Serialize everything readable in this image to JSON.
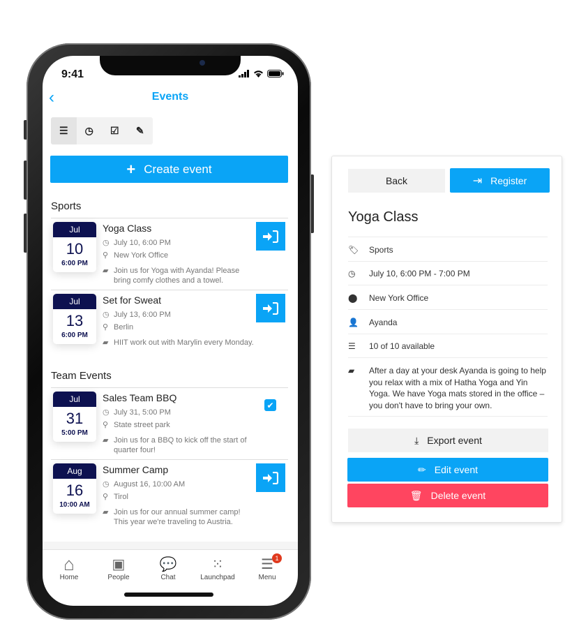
{
  "status": {
    "time": "9:41"
  },
  "nav": {
    "title": "Events"
  },
  "create_label": "Create event",
  "sections": [
    {
      "title": "Sports",
      "events": [
        {
          "month": "Jul",
          "day": "10",
          "time": "6:00 PM",
          "title": "Yoga Class",
          "when": "July 10, 6:00 PM",
          "where": "New York Office",
          "desc": "Join us for Yoga with Ayanda! Please bring comfy clothes and a towel.",
          "registered": false
        },
        {
          "month": "Jul",
          "day": "13",
          "time": "6:00 PM",
          "title": "Set for Sweat",
          "when": "July 13, 6:00 PM",
          "where": "Berlin",
          "desc": "HIIT work out with Marylin every Monday.",
          "registered": false
        }
      ]
    },
    {
      "title": "Team Events",
      "events": [
        {
          "month": "Jul",
          "day": "31",
          "time": "5:00 PM",
          "title": "Sales Team BBQ",
          "when": "July 31, 5:00 PM",
          "where": "State street park",
          "desc": "Join us for a BBQ to kick off the start of quarter four!",
          "registered": true
        },
        {
          "month": "Aug",
          "day": "16",
          "time": "10:00 AM",
          "title": "Summer Camp",
          "when": "August 16, 10:00 AM",
          "where": "Tirol",
          "desc": "Join us for our annual summer camp! This year we're traveling to Austria.",
          "registered": false
        }
      ]
    }
  ],
  "tabbar": [
    {
      "label": "Home",
      "icon": "home-icon"
    },
    {
      "label": "People",
      "icon": "contacts-icon"
    },
    {
      "label": "Chat",
      "icon": "chat-icon"
    },
    {
      "label": "Launchpad",
      "icon": "grid-icon"
    },
    {
      "label": "Menu",
      "icon": "menu-icon",
      "badge": "1"
    }
  ],
  "detail": {
    "back": "Back",
    "register": "Register",
    "title": "Yoga Class",
    "category": "Sports",
    "datetime": "July 10, 6:00 PM - 7:00 PM",
    "location": "New York Office",
    "host": "Ayanda",
    "capacity": "10 of 10 available",
    "description": "After a day at your desk Ayanda is going to help you relax with a mix of Hatha Yoga and Yin Yoga. We have Yoga mats stored in the office – you don't have to bring your own.",
    "export": "Export event",
    "edit": "Edit event",
    "delete": "Delete event"
  },
  "colors": {
    "accent": "#0aa4f6",
    "navy": "#0d1150",
    "danger": "#ff4560",
    "badge": "#e03a1e"
  }
}
